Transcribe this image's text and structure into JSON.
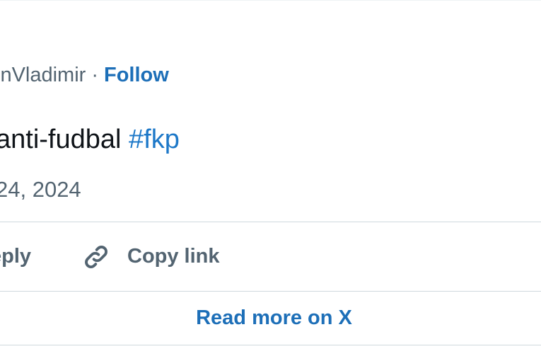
{
  "tweet": {
    "author_handle": "inVladimir",
    "separator": "·",
    "follow_label": "Follow",
    "text": "anti-fudbal ",
    "hashtag": "#fkp",
    "timestamp": "24, 2024"
  },
  "actions": {
    "reply_label": "eply",
    "copy_link_label": "Copy link",
    "copy_link_icon": "link-icon"
  },
  "footer": {
    "read_more_label": "Read more on X"
  },
  "colors": {
    "link_blue": "#1d6fb8",
    "secondary_text": "#536471",
    "divider": "#cfd9de"
  }
}
